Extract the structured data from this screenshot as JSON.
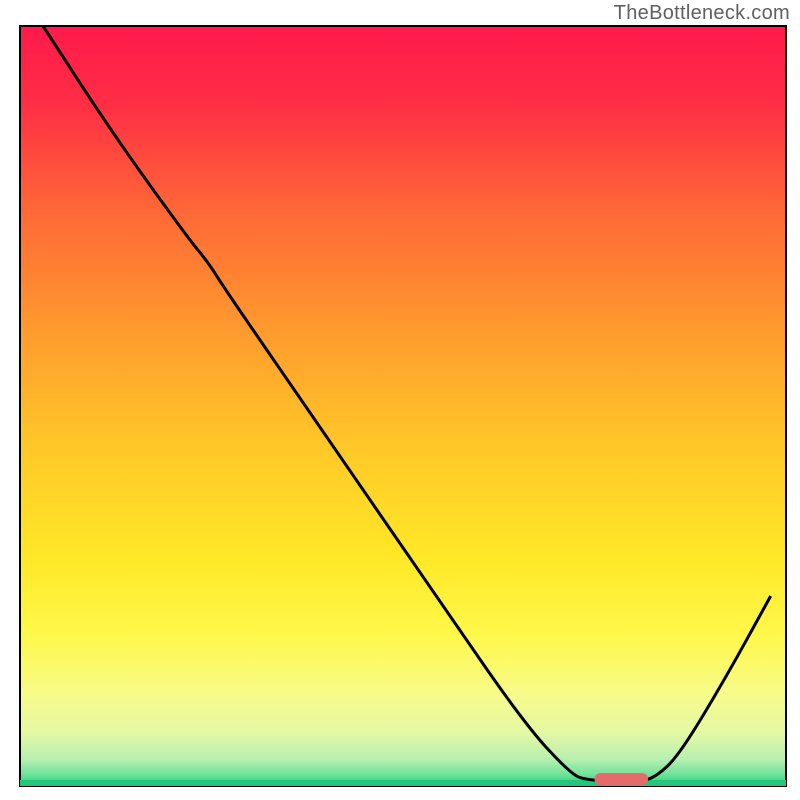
{
  "watermark": "TheBottleneck.com",
  "chart_data": {
    "type": "line",
    "title": "",
    "xlabel": "",
    "ylabel": "",
    "xlim": [
      0,
      100
    ],
    "ylim": [
      0,
      100
    ],
    "background_gradient_stops": [
      {
        "offset": 0.0,
        "color": "#ff1a4c"
      },
      {
        "offset": 0.1,
        "color": "#ff2d45"
      },
      {
        "offset": 0.25,
        "color": "#ff6a36"
      },
      {
        "offset": 0.4,
        "color": "#ff9a2e"
      },
      {
        "offset": 0.55,
        "color": "#ffc728"
      },
      {
        "offset": 0.7,
        "color": "#ffe827"
      },
      {
        "offset": 0.8,
        "color": "#fff84a"
      },
      {
        "offset": 0.88,
        "color": "#f7fb8a"
      },
      {
        "offset": 0.93,
        "color": "#e4f8a4"
      },
      {
        "offset": 0.965,
        "color": "#b7f0b0"
      },
      {
        "offset": 0.985,
        "color": "#6fe29a"
      },
      {
        "offset": 1.0,
        "color": "#22c777"
      }
    ],
    "series": [
      {
        "name": "curve",
        "stroke": "#000000",
        "points": [
          {
            "x": 3.0,
            "y": 100.0
          },
          {
            "x": 12.0,
            "y": 86.0
          },
          {
            "x": 22.0,
            "y": 72.0
          },
          {
            "x": 24.5,
            "y": 69.0
          },
          {
            "x": 27.0,
            "y": 65.0
          },
          {
            "x": 40.0,
            "y": 46.0
          },
          {
            "x": 55.0,
            "y": 24.0
          },
          {
            "x": 66.0,
            "y": 8.0
          },
          {
            "x": 72.0,
            "y": 1.5
          },
          {
            "x": 74.0,
            "y": 0.8
          },
          {
            "x": 78.0,
            "y": 0.6
          },
          {
            "x": 81.0,
            "y": 0.6
          },
          {
            "x": 83.0,
            "y": 1.2
          },
          {
            "x": 86.0,
            "y": 4.0
          },
          {
            "x": 92.0,
            "y": 14.0
          },
          {
            "x": 98.0,
            "y": 25.0
          }
        ]
      }
    ],
    "marker": {
      "name": "optimal-range",
      "x_start": 75.0,
      "x_end": 82.0,
      "y": 0.9,
      "color": "#e56a6a"
    },
    "bottom_line_color": "#22c777"
  }
}
